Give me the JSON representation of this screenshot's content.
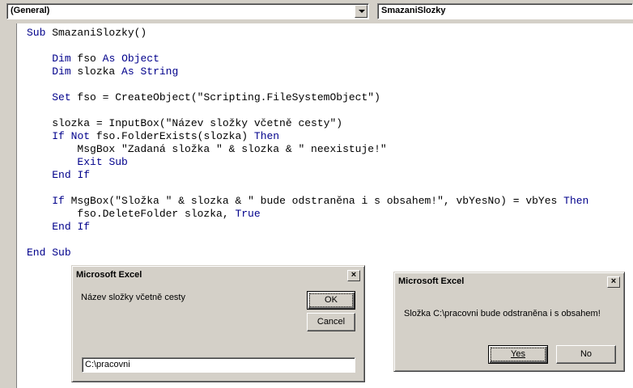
{
  "toolbar": {
    "object_combo": "(General)",
    "procedure_combo": "SmazaniSlozky"
  },
  "code_lines": [
    [
      {
        "t": "Sub",
        "k": true
      },
      {
        "t": " SmazaniSlozky()",
        "k": false
      }
    ],
    [],
    [
      {
        "t": "    ",
        "k": false
      },
      {
        "t": "Dim",
        "k": true
      },
      {
        "t": " fso ",
        "k": false
      },
      {
        "t": "As",
        "k": true
      },
      {
        "t": " ",
        "k": false
      },
      {
        "t": "Object",
        "k": true
      }
    ],
    [
      {
        "t": "    ",
        "k": false
      },
      {
        "t": "Dim",
        "k": true
      },
      {
        "t": " slozka ",
        "k": false
      },
      {
        "t": "As",
        "k": true
      },
      {
        "t": " ",
        "k": false
      },
      {
        "t": "String",
        "k": true
      }
    ],
    [],
    [
      {
        "t": "    ",
        "k": false
      },
      {
        "t": "Set",
        "k": true
      },
      {
        "t": " fso = CreateObject(\"Scripting.FileSystemObject\")",
        "k": false
      }
    ],
    [],
    [
      {
        "t": "    slozka = InputBox(\"Název složky včetně cesty\")",
        "k": false
      }
    ],
    [
      {
        "t": "    ",
        "k": false
      },
      {
        "t": "If",
        "k": true
      },
      {
        "t": " ",
        "k": false
      },
      {
        "t": "Not",
        "k": true
      },
      {
        "t": " fso.FolderExists(slozka) ",
        "k": false
      },
      {
        "t": "Then",
        "k": true
      }
    ],
    [
      {
        "t": "        MsgBox \"Zadaná složka \" & slozka & \" neexistuje!\"",
        "k": false
      }
    ],
    [
      {
        "t": "        ",
        "k": false
      },
      {
        "t": "Exit",
        "k": true
      },
      {
        "t": " ",
        "k": false
      },
      {
        "t": "Sub",
        "k": true
      }
    ],
    [
      {
        "t": "    ",
        "k": false
      },
      {
        "t": "End",
        "k": true
      },
      {
        "t": " ",
        "k": false
      },
      {
        "t": "If",
        "k": true
      }
    ],
    [],
    [
      {
        "t": "    ",
        "k": false
      },
      {
        "t": "If",
        "k": true
      },
      {
        "t": " MsgBox(\"Složka \" & slozka & \" bude odstraněna i s obsahem!\", vbYesNo) = vbYes ",
        "k": false
      },
      {
        "t": "Then",
        "k": true
      }
    ],
    [
      {
        "t": "        fso.DeleteFolder slozka, ",
        "k": false
      },
      {
        "t": "True",
        "k": true
      }
    ],
    [
      {
        "t": "    ",
        "k": false
      },
      {
        "t": "End",
        "k": true
      },
      {
        "t": " ",
        "k": false
      },
      {
        "t": "If",
        "k": true
      }
    ],
    [],
    [
      {
        "t": "End",
        "k": true
      },
      {
        "t": " ",
        "k": false
      },
      {
        "t": "Sub",
        "k": true
      }
    ]
  ],
  "inputbox": {
    "title": "Microsoft Excel",
    "prompt": "Název složky včetně cesty",
    "ok_label": "OK",
    "cancel_label": "Cancel",
    "value": "C:\\pracovni"
  },
  "msgbox": {
    "title": "Microsoft Excel",
    "message": "Složka C:\\pracovni bude odstraněna i s obsahem!",
    "yes_label": "Yes",
    "no_label": "No"
  },
  "icons": {
    "close": "close-icon",
    "dropdown": "chevron-down-icon"
  },
  "colors": {
    "keyword": "#00008b",
    "dialog_bg": "#d4d0c8"
  }
}
